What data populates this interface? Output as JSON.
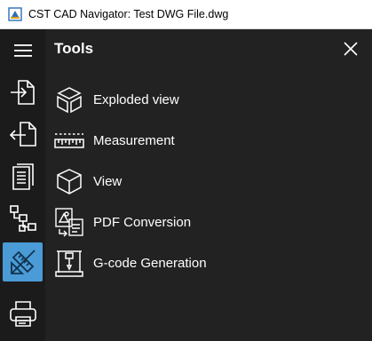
{
  "window": {
    "title": "CST CAD Navigator: Test DWG File.dwg"
  },
  "rail": {
    "items": [
      {
        "icon": "menu-icon",
        "active": false
      },
      {
        "icon": "import-file-icon",
        "active": false
      },
      {
        "icon": "export-file-icon",
        "active": false
      },
      {
        "icon": "document-pages-icon",
        "active": false
      },
      {
        "icon": "layer-tree-icon",
        "active": false
      },
      {
        "icon": "tools-icon",
        "active": true
      },
      {
        "icon": "print-icon",
        "active": false
      }
    ]
  },
  "panel": {
    "title": "Tools",
    "close_icon": "close-icon",
    "items": [
      {
        "label": "Exploded view",
        "icon": "exploded-cube-icon"
      },
      {
        "label": "Measurement",
        "icon": "ruler-icon"
      },
      {
        "label": "View",
        "icon": "cube-icon"
      },
      {
        "label": "PDF Conversion",
        "icon": "pdf-conversion-icon"
      },
      {
        "label": "G-code Generation",
        "icon": "gcode-machine-icon"
      }
    ]
  },
  "colors": {
    "rail_bg": "#1b1b1b",
    "panel_bg": "#222222",
    "accent": "#4a9bd6",
    "text": "#ffffff"
  }
}
